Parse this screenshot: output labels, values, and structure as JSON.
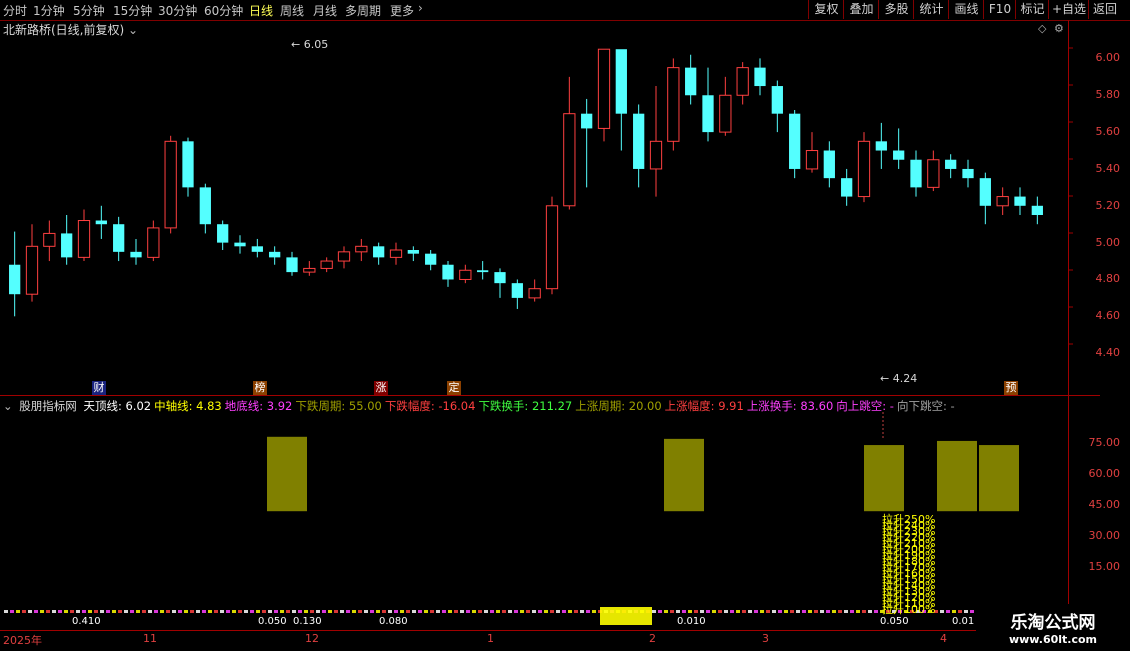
{
  "toolbar": {
    "timeframes": [
      {
        "label": "分时",
        "x": 3,
        "active": false
      },
      {
        "label": "1分钟",
        "x": 33,
        "active": false
      },
      {
        "label": "5分钟",
        "x": 73,
        "active": false
      },
      {
        "label": "15分钟",
        "x": 113,
        "active": false
      },
      {
        "label": "30分钟",
        "x": 158,
        "active": false
      },
      {
        "label": "60分钟",
        "x": 204,
        "active": false
      },
      {
        "label": "日线",
        "x": 249,
        "active": true
      },
      {
        "label": "周线",
        "x": 280,
        "active": false
      },
      {
        "label": "月线",
        "x": 313,
        "active": false
      },
      {
        "label": "多周期",
        "x": 345,
        "active": false
      },
      {
        "label": "更多",
        "x": 390,
        "active": false
      }
    ],
    "right_buttons": [
      "复权",
      "叠加",
      "多股",
      "统计",
      "画线",
      "F10",
      "标记",
      "+自选",
      "返回"
    ]
  },
  "stock": {
    "name_line": "北新路桥(日线,前复权)"
  },
  "price_axis": [
    "6.00",
    "5.80",
    "5.60",
    "5.40",
    "5.20",
    "5.00",
    "4.80",
    "4.60",
    "4.40"
  ],
  "annotations": {
    "high": "6.05",
    "low": "4.24"
  },
  "events": [
    "财",
    "榜",
    "涨",
    "定",
    "预"
  ],
  "indicator": {
    "name": "股朋指标网",
    "items": [
      {
        "label": "天顶线: 6.02",
        "color": "#ffffff"
      },
      {
        "label": "中轴线: 4.83",
        "color": "#ffff00"
      },
      {
        "label": "地底线: 3.92",
        "color": "#ff40ff"
      },
      {
        "label": "下跌周期: 55.00",
        "color": "#a0a000"
      },
      {
        "label": "下跌幅度: -16.04",
        "color": "#ff4040"
      },
      {
        "label": "下跌换手: 211.27",
        "color": "#40ff40"
      },
      {
        "label": "上涨周期: 20.00",
        "color": "#a0a000"
      },
      {
        "label": "上涨幅度: 9.91",
        "color": "#ff4040"
      },
      {
        "label": "上涨换手: 83.60",
        "color": "#ff40ff"
      },
      {
        "label": "向上跳空: -",
        "color": "#ff40ff"
      },
      {
        "label": "向下跳空: -",
        "color": "#a0a0a0"
      }
    ],
    "axis": [
      "75.00",
      "60.00",
      "45.00",
      "30.00",
      "15.00"
    ]
  },
  "lift_labels": [
    "拉升250%",
    "拉升240%",
    "拉升230%",
    "拉升220%",
    "拉升210%",
    "拉升200%",
    "拉升190%",
    "拉升180%",
    "拉升170%",
    "拉升160%",
    "拉升150%",
    "拉升140%",
    "拉升130%",
    "拉升120%",
    "拉升110%",
    "拉升100%"
  ],
  "small_values": [
    "0.410",
    "0.050",
    "0.130",
    "0.080",
    "0.010",
    "0.050",
    "0.01"
  ],
  "dates": [
    "2025年",
    "11",
    "12",
    "1",
    "2",
    "3",
    "4"
  ],
  "watermark": {
    "line1": "乐淘公式网",
    "line2": "www.60lt.com"
  },
  "colors": {
    "up": "#ff4040",
    "down": "#54ffff",
    "bar": "#808000",
    "axis": "#e04040"
  },
  "chart_data": {
    "type": "candlestick",
    "ylim": [
      4.2,
      6.1
    ],
    "candles": [
      [
        4.88,
        4.72,
        5.06,
        4.6
      ],
      [
        4.72,
        4.98,
        5.1,
        4.68
      ],
      [
        4.98,
        5.05,
        5.12,
        4.9
      ],
      [
        5.05,
        4.92,
        5.15,
        4.88
      ],
      [
        4.92,
        5.12,
        5.18,
        4.9
      ],
      [
        5.12,
        5.1,
        5.2,
        5.02
      ],
      [
        5.1,
        4.95,
        5.14,
        4.9
      ],
      [
        4.95,
        4.92,
        5.02,
        4.88
      ],
      [
        4.92,
        5.08,
        5.12,
        4.9
      ],
      [
        5.08,
        5.55,
        5.58,
        5.05
      ],
      [
        5.55,
        5.3,
        5.57,
        5.25
      ],
      [
        5.3,
        5.1,
        5.32,
        5.05
      ],
      [
        5.1,
        5.0,
        5.12,
        4.96
      ],
      [
        5.0,
        4.98,
        5.04,
        4.94
      ],
      [
        4.98,
        4.95,
        5.02,
        4.92
      ],
      [
        4.95,
        4.92,
        4.98,
        4.88
      ],
      [
        4.92,
        4.84,
        4.95,
        4.82
      ],
      [
        4.84,
        4.86,
        4.9,
        4.82
      ],
      [
        4.86,
        4.9,
        4.92,
        4.84
      ],
      [
        4.9,
        4.95,
        4.98,
        4.86
      ],
      [
        4.95,
        4.98,
        5.02,
        4.9
      ],
      [
        4.98,
        4.92,
        5.0,
        4.88
      ],
      [
        4.92,
        4.96,
        5.0,
        4.88
      ],
      [
        4.96,
        4.94,
        4.98,
        4.9
      ],
      [
        4.94,
        4.88,
        4.96,
        4.85
      ],
      [
        4.88,
        4.8,
        4.9,
        4.76
      ],
      [
        4.8,
        4.85,
        4.88,
        4.78
      ],
      [
        4.85,
        4.84,
        4.9,
        4.8
      ],
      [
        4.84,
        4.78,
        4.86,
        4.7
      ],
      [
        4.78,
        4.7,
        4.8,
        4.64
      ],
      [
        4.7,
        4.75,
        4.8,
        4.68
      ],
      [
        4.75,
        5.2,
        5.25,
        4.72
      ],
      [
        5.2,
        5.7,
        5.9,
        5.18
      ],
      [
        5.7,
        5.62,
        5.78,
        5.3
      ],
      [
        5.62,
        6.05,
        6.05,
        5.55
      ],
      [
        6.05,
        5.7,
        6.02,
        5.5
      ],
      [
        5.7,
        5.4,
        5.75,
        5.3
      ],
      [
        5.4,
        5.55,
        5.85,
        5.25
      ],
      [
        5.55,
        5.95,
        6.0,
        5.5
      ],
      [
        5.95,
        5.8,
        6.02,
        5.75
      ],
      [
        5.8,
        5.6,
        5.95,
        5.55
      ],
      [
        5.6,
        5.8,
        5.9,
        5.58
      ],
      [
        5.8,
        5.95,
        5.98,
        5.75
      ],
      [
        5.95,
        5.85,
        6.0,
        5.8
      ],
      [
        5.85,
        5.7,
        5.88,
        5.6
      ],
      [
        5.7,
        5.4,
        5.72,
        5.35
      ],
      [
        5.4,
        5.5,
        5.6,
        5.38
      ],
      [
        5.5,
        5.35,
        5.55,
        5.3
      ],
      [
        5.35,
        5.25,
        5.4,
        5.2
      ],
      [
        5.25,
        5.55,
        5.6,
        5.22
      ],
      [
        5.55,
        5.5,
        5.65,
        5.4
      ],
      [
        5.5,
        5.45,
        5.62,
        5.4
      ],
      [
        5.45,
        5.3,
        5.5,
        5.25
      ],
      [
        5.3,
        5.45,
        5.5,
        5.28
      ],
      [
        5.45,
        5.4,
        5.48,
        5.35
      ],
      [
        5.4,
        5.35,
        5.45,
        5.3
      ],
      [
        5.35,
        5.2,
        5.38,
        5.1
      ],
      [
        5.2,
        5.25,
        5.3,
        5.15
      ],
      [
        5.25,
        5.2,
        5.3,
        5.15
      ],
      [
        5.2,
        5.15,
        5.25,
        5.1
      ]
    ],
    "indicator_bars": [
      {
        "x": 285,
        "top": 78
      },
      {
        "x": 682,
        "top": 77
      },
      {
        "x": 882,
        "top": 74
      },
      {
        "x": 955,
        "top": 76
      },
      {
        "x": 997,
        "top": 74
      }
    ]
  }
}
